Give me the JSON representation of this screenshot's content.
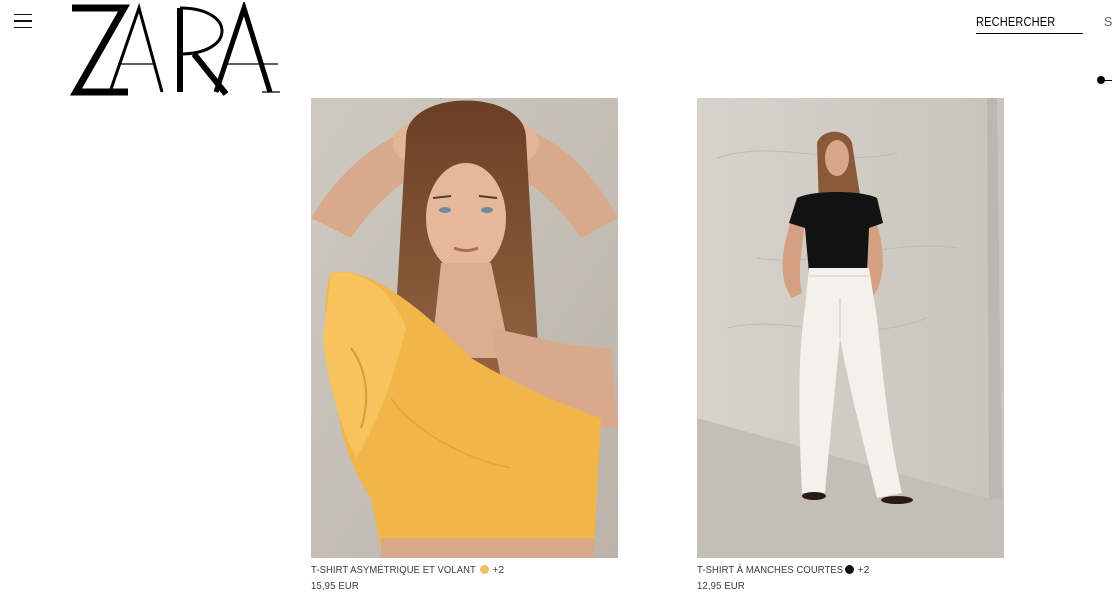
{
  "brand": {
    "name": "ZARA"
  },
  "header": {
    "menu_icon": "hamburger-menu-icon",
    "search_label": "RECHERCHER",
    "login_label": "S"
  },
  "products": [
    {
      "name": "T-SHIRT ASYMÉTRIQUE ET VOLANT",
      "color_swatch": "#f5bf6a",
      "more_colors": "+2",
      "price": "15,95 EUR"
    },
    {
      "name": "T-SHIRT À MANCHES COURTES",
      "color_swatch": "#111111",
      "more_colors": "+2",
      "price": "12,95 EUR"
    }
  ]
}
